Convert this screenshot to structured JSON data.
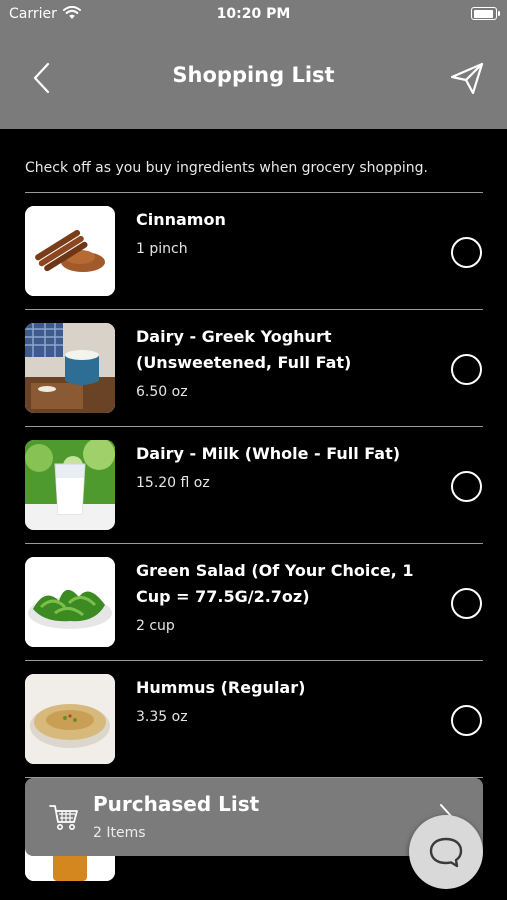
{
  "status_bar": {
    "carrier": "Carrier",
    "time": "10:20 PM"
  },
  "header": {
    "title": "Shopping List",
    "back_icon": "chevron-left-icon",
    "send_icon": "paper-plane-icon"
  },
  "instructions": "Check off as you buy ingredients when grocery shopping.",
  "items": [
    {
      "name": "Cinnamon",
      "qty": "1 pinch",
      "checked": false
    },
    {
      "name": "Dairy - Greek Yoghurt (Unsweetened, Full Fat)",
      "qty": "6.50 oz",
      "checked": false
    },
    {
      "name": "Dairy - Milk (Whole - Full Fat)",
      "qty": "15.20 fl oz",
      "checked": false
    },
    {
      "name": "Green Salad (Of Your Choice, 1 Cup = 77.5G/2.7oz)",
      "qty": "2 cup",
      "checked": false
    },
    {
      "name": "Hummus (Regular)",
      "qty": "3.35 oz",
      "checked": false
    }
  ],
  "purchased": {
    "title": "Purchased List",
    "count": "2 Items",
    "icon": "shopping-cart-icon"
  },
  "chat": {
    "icon": "chat-bubble-icon"
  },
  "colors": {
    "background": "#000000",
    "header": "#7b7b7b",
    "text": "#ffffff",
    "chat_button": "#d9d9d9"
  }
}
